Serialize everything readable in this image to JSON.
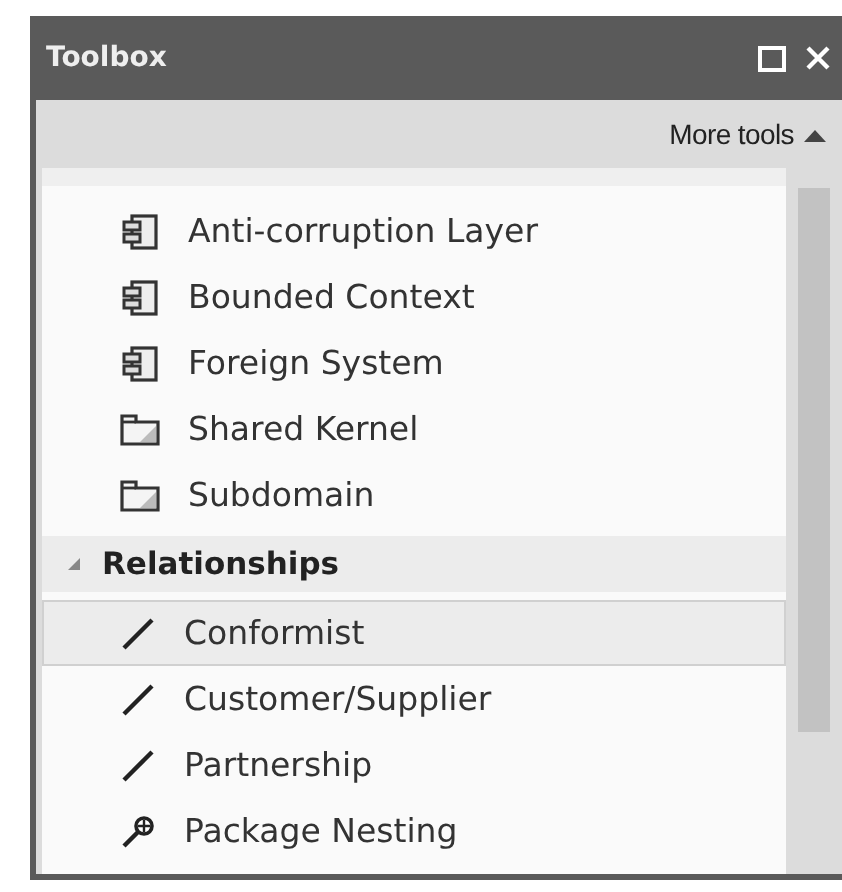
{
  "window": {
    "title": "Toolbox"
  },
  "more_tools": {
    "label": "More tools",
    "expanded": true
  },
  "items": [
    {
      "kind": "component",
      "label": "Anti-corruption Layer",
      "selected": false
    },
    {
      "kind": "component",
      "label": "Bounded Context",
      "selected": false
    },
    {
      "kind": "component",
      "label": "Foreign System",
      "selected": false
    },
    {
      "kind": "package",
      "label": "Shared Kernel",
      "selected": false
    },
    {
      "kind": "package",
      "label": "Subdomain",
      "selected": false
    }
  ],
  "group": {
    "label": "Relationships",
    "expanded": true,
    "items": [
      {
        "kind": "connector",
        "label": "Conformist",
        "selected": true
      },
      {
        "kind": "connector",
        "label": "Customer/Supplier",
        "selected": false
      },
      {
        "kind": "connector",
        "label": "Partnership",
        "selected": false
      },
      {
        "kind": "nesting",
        "label": "Package Nesting",
        "selected": false
      }
    ]
  }
}
